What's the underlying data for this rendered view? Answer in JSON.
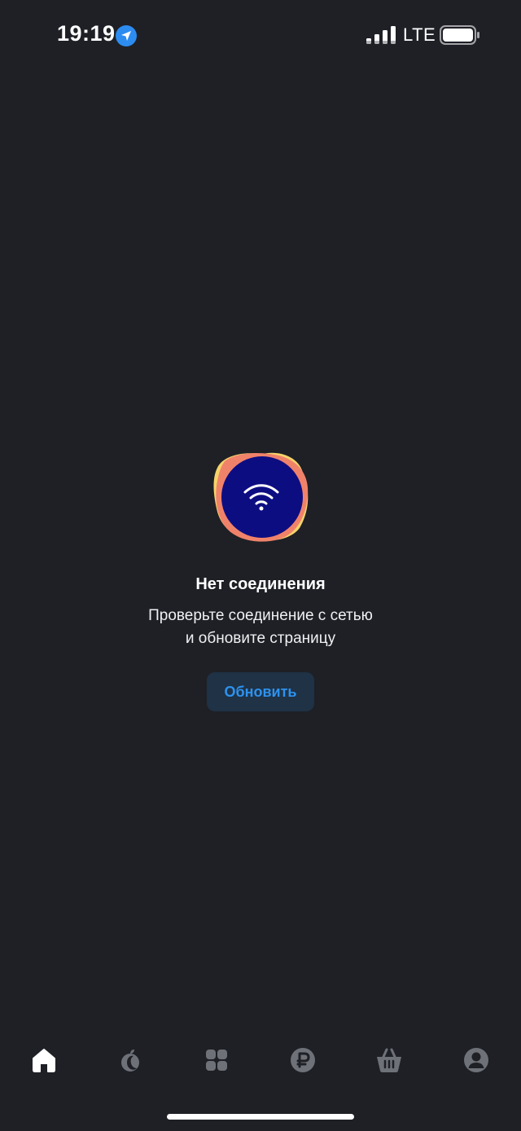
{
  "status_bar": {
    "time": "19:19",
    "network": "LTE",
    "icons": [
      "location-arrow-icon",
      "signal-icon",
      "battery-icon"
    ]
  },
  "error_state": {
    "illustration_icon": "wifi-icon",
    "title": "Нет соединения",
    "message_line_1": "Проверьте соединение с сетью",
    "message_line_2": "и обновите страницу",
    "button_label": "Обновить"
  },
  "tab_bar": {
    "tabs": [
      {
        "icon": "home-icon",
        "active": true
      },
      {
        "icon": "fruit-icon",
        "active": false
      },
      {
        "icon": "catalog-icon",
        "active": false
      },
      {
        "icon": "ruble-icon",
        "active": false
      },
      {
        "icon": "basket-icon",
        "active": false
      },
      {
        "icon": "profile-icon",
        "active": false
      }
    ]
  },
  "colors": {
    "background": "#1e2026",
    "accent": "#2d92ee",
    "button_bg": "#1f3246",
    "tab_active": "#ffffff",
    "tab_inactive": "#6e7178",
    "illustration_circle": "#0d0d82",
    "illustration_blob_orange": "#f0826a",
    "illustration_blob_yellow": "#f5d36a"
  }
}
